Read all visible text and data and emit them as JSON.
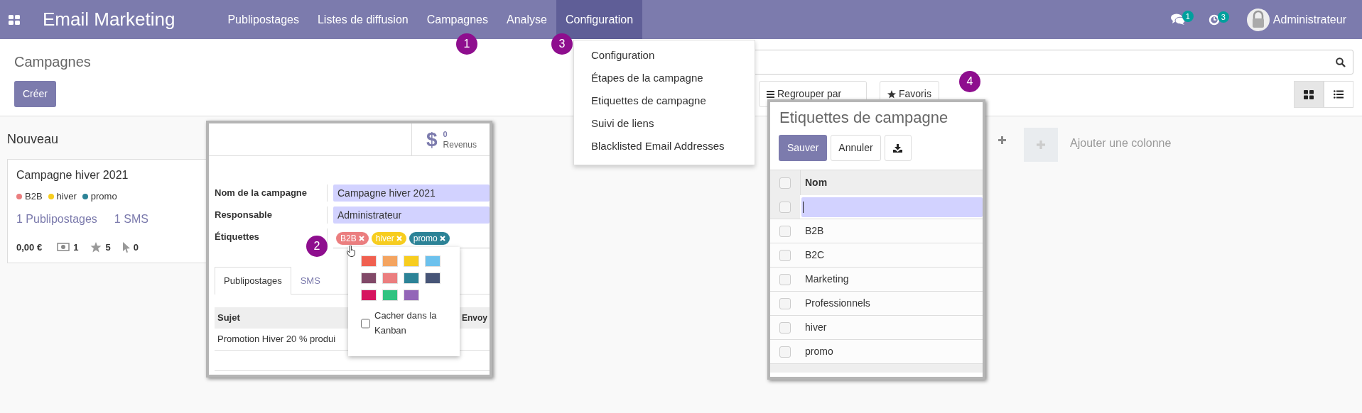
{
  "navbar": {
    "app_title": "Email Marketing",
    "menu": [
      {
        "label": "Publipostages",
        "selected": false
      },
      {
        "label": "Listes de diffusion",
        "selected": false
      },
      {
        "label": "Campagnes",
        "selected": false
      },
      {
        "label": "Analyse",
        "selected": false
      },
      {
        "label": "Configuration",
        "selected": true
      }
    ],
    "messages_count": "1",
    "activities_count": "3",
    "user": "Administrateur"
  },
  "config_menu": {
    "items": [
      "Configuration",
      "Étapes de la campagne",
      "Etiquettes de campagne",
      "Suivi de liens",
      "Blacklisted Email Addresses"
    ]
  },
  "control_panel": {
    "title": "Campagnes",
    "create_button": "Créer",
    "group_by_button": "Regrouper par",
    "favorites_button": "Favoris",
    "views": [
      {
        "kind": "kanban",
        "selected": true
      },
      {
        "kind": "list",
        "selected": false
      }
    ]
  },
  "kanban": {
    "columns": [
      {
        "title": "Nouveau",
        "cards": [
          {
            "name": "Campagne hiver 2021",
            "tags": [
              {
                "label": "B2B",
                "color": "#eb7e7f"
              },
              {
                "label": "hiver",
                "color": "#f7cd1f"
              },
              {
                "label": "promo",
                "color": "#2c8397"
              }
            ],
            "links": [
              "1 Publipostages",
              "1 SMS"
            ],
            "revenue": "0,00 €",
            "stats": [
              {
                "kind": "mailing",
                "value": "1"
              },
              {
                "kind": "star",
                "value": "5"
              },
              {
                "kind": "click",
                "value": "0"
              }
            ]
          }
        ]
      }
    ],
    "add_column": "Ajouter une colonne"
  },
  "campaign_form": {
    "stat": {
      "icon": "$",
      "value": "0",
      "label": "Revenus"
    },
    "fields": [
      {
        "label": "Nom de la campagne",
        "value": "Campagne hiver 2021"
      },
      {
        "label": "Responsable",
        "value": "Administrateur"
      }
    ],
    "tags_label": "Étiquettes",
    "tags": [
      {
        "label": "B2B",
        "color": "#eb7e7f"
      },
      {
        "label": "hiver",
        "color": "#f7cd1f"
      },
      {
        "label": "promo",
        "color": "#2c8397"
      }
    ],
    "color_picker": {
      "colors": [
        {
          "color": "#f06050"
        },
        {
          "color": "#f4a460"
        },
        {
          "color": "#f7cd1f"
        },
        {
          "color": "#6cc1ed"
        },
        {
          "color": "#814968"
        },
        {
          "color": "#eb7e7f"
        },
        {
          "color": "#2c8397"
        },
        {
          "color": "#475577"
        },
        {
          "color": "#d6145f"
        },
        {
          "color": "#30c381"
        },
        {
          "color": "#9365b8"
        }
      ],
      "hide_in_kanban": {
        "label": "Cacher dans la Kanban",
        "checked": false
      }
    },
    "tabs": [
      {
        "label": "Publipostages",
        "selected": true
      },
      {
        "label": "SMS",
        "selected": false
      }
    ],
    "table": {
      "columns": [
        "Sujet",
        "Envoy"
      ],
      "rows": [
        [
          "Promotion Hiver 20 % produi"
        ]
      ]
    }
  },
  "tags_list": {
    "title": "Etiquettes de campagne",
    "save_button": "Sauver",
    "cancel_button": "Annuler",
    "column": "Nom",
    "select_all_checked": false,
    "new_row": {
      "checked": false
    },
    "rows": [
      {
        "name": "B2B",
        "checked": false
      },
      {
        "name": "B2C",
        "checked": false
      },
      {
        "name": "Marketing",
        "checked": false
      },
      {
        "name": "Professionnels",
        "checked": false
      },
      {
        "name": "hiver",
        "checked": false
      },
      {
        "name": "promo",
        "checked": false
      }
    ]
  },
  "step_markers": [
    "1",
    "2",
    "3",
    "4"
  ]
}
